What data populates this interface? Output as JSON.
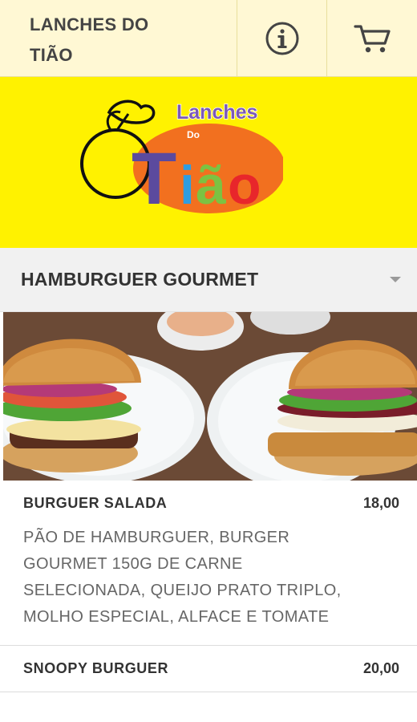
{
  "header": {
    "title_line1": "LANCHES DO",
    "title_line2": "TIÃO",
    "info_icon": "info-circle-icon",
    "cart_icon": "shopping-cart-icon"
  },
  "banner": {
    "logo_word_top": "Lanches",
    "logo_word_mid": "Do",
    "logo_letters": [
      "T",
      "i",
      "ã",
      "o"
    ],
    "colors": {
      "background": "#fff200",
      "oval": "#f2701f",
      "T": "#5b4a9e",
      "i": "#2f9de0",
      "a": "#7cc242",
      "o": "#e8262b"
    }
  },
  "section": {
    "title": "HAMBURGUER GOURMET"
  },
  "items": [
    {
      "name": "BURGUER SALADA",
      "price": "18,00",
      "description": "PÃO DE HAMBURGUER, BURGER GOURMET 150G DE CARNE SELECIONADA, QUEIJO PRATO TRIPLO, MOLHO ESPECIAL, ALFACE E TOMATE"
    },
    {
      "name": "SNOOPY BURGUER",
      "price": "20,00",
      "description": ""
    }
  ]
}
